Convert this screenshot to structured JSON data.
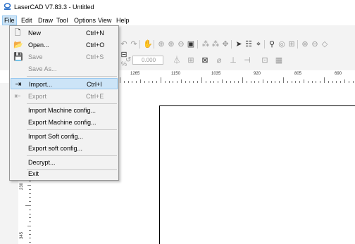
{
  "window": {
    "title": "LaserCAD V7.83.3 - Untitled"
  },
  "menubar": {
    "items": [
      "File",
      "Edit",
      "Draw",
      "Tool",
      "Options",
      "View",
      "Help"
    ]
  },
  "toolbar": {
    "angle_value": "0.000"
  },
  "file_menu": {
    "items": [
      {
        "label": "New",
        "shortcut": "Ctrl+N",
        "icon": "new-file-icon",
        "disabled": false
      },
      {
        "label": "Open...",
        "shortcut": "Ctrl+O",
        "icon": "open-folder-icon",
        "disabled": false
      },
      {
        "label": "Save",
        "shortcut": "Ctrl+S",
        "icon": "save-icon",
        "disabled": true
      },
      {
        "label": "Save As...",
        "shortcut": "",
        "icon": "",
        "disabled": true
      },
      {
        "label": "Import...",
        "shortcut": "Ctrl+I",
        "icon": "import-icon",
        "disabled": false,
        "highlighted": true
      },
      {
        "label": "Export",
        "shortcut": "Ctrl+E",
        "icon": "export-icon",
        "disabled": true
      },
      {
        "label": "Import Machine config...",
        "shortcut": "",
        "icon": "",
        "disabled": false
      },
      {
        "label": "Export Machine config...",
        "shortcut": "",
        "icon": "",
        "disabled": false
      },
      {
        "label": "Import Soft config...",
        "shortcut": "",
        "icon": "",
        "disabled": false
      },
      {
        "label": "Export soft config...",
        "shortcut": "",
        "icon": "",
        "disabled": false
      },
      {
        "label": "Decrypt...",
        "shortcut": "",
        "icon": "",
        "disabled": false
      },
      {
        "label": "Exit",
        "shortcut": "",
        "icon": "",
        "disabled": false
      }
    ]
  },
  "ruler_h": {
    "labels": [
      "1265",
      "1150",
      "1035",
      "920",
      "805",
      "690"
    ]
  },
  "ruler_v": {
    "labels": [
      "230",
      "345"
    ]
  }
}
